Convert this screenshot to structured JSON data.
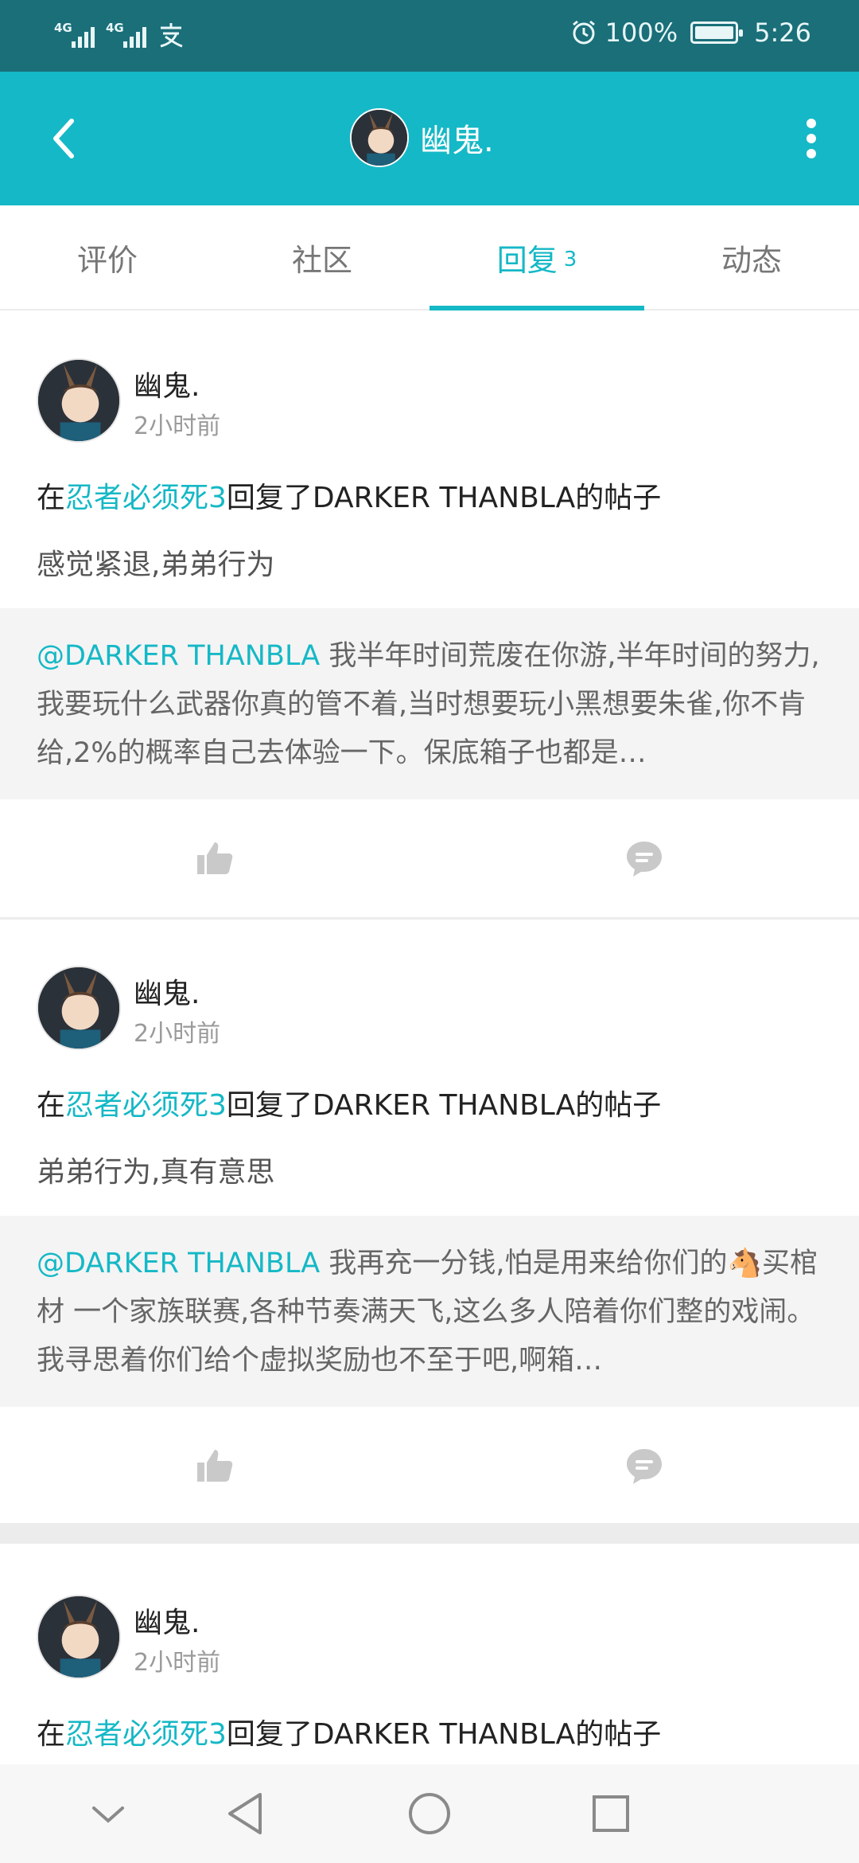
{
  "status_bar": {
    "network_1": "4G",
    "network_2": "4G",
    "battery": "100%",
    "time": "5:26",
    "icons": [
      "signal-icon",
      "signal-icon",
      "alipay-icon",
      "alarm-icon",
      "battery-charging-icon"
    ]
  },
  "header": {
    "username": "幽鬼.",
    "icons": [
      "back-icon",
      "avatar",
      "more-icon"
    ]
  },
  "tabs": [
    {
      "label": "评价",
      "count": ""
    },
    {
      "label": "社区",
      "count": ""
    },
    {
      "label": "回复",
      "count": "3"
    },
    {
      "label": "动态",
      "count": ""
    }
  ],
  "active_tab": "回复",
  "feed": [
    {
      "username": "幽鬼.",
      "time": "2小时前",
      "action_prefix": "在",
      "game": "忍者必须死3",
      "action_suffix": "回复了DARKER THANBLA的帖子",
      "reply": "感觉紧退,弟弟行为",
      "quote_mention": "@DARKER THANBLA",
      "quote_text": " 我半年时间荒废在你游,半年时间的努力,我要玩什么武器你真的管不着,当时想要玩小黑想要朱雀,你不肯给,2%的概率自己去体验一下。保底箱子也都是…"
    },
    {
      "username": "幽鬼.",
      "time": "2小时前",
      "action_prefix": "在",
      "game": "忍者必须死3",
      "action_suffix": "回复了DARKER THANBLA的帖子",
      "reply": "弟弟行为,真有意思",
      "quote_mention": "@DARKER THANBLA",
      "quote_text": " 我再充一分钱,怕是用来给你们的🐴买棺材 一个家族联赛,各种节奏满天飞,这么多人陪着你们整的戏闹。我寻思着你们给个虚拟奖励也不至于吧,啊箱…"
    },
    {
      "username": "幽鬼.",
      "time": "2小时前",
      "action_prefix": "在",
      "game": "忍者必须死3",
      "action_suffix": "回复了DARKER THANBLA的帖子"
    }
  ],
  "colors": {
    "status_bar": "#1a6f79",
    "accent": "#15b8c6",
    "quote_bg": "#f4f4f4"
  },
  "nav_icons": [
    "collapse-icon",
    "back-triangle-icon",
    "home-circle-icon",
    "recents-square-icon"
  ]
}
